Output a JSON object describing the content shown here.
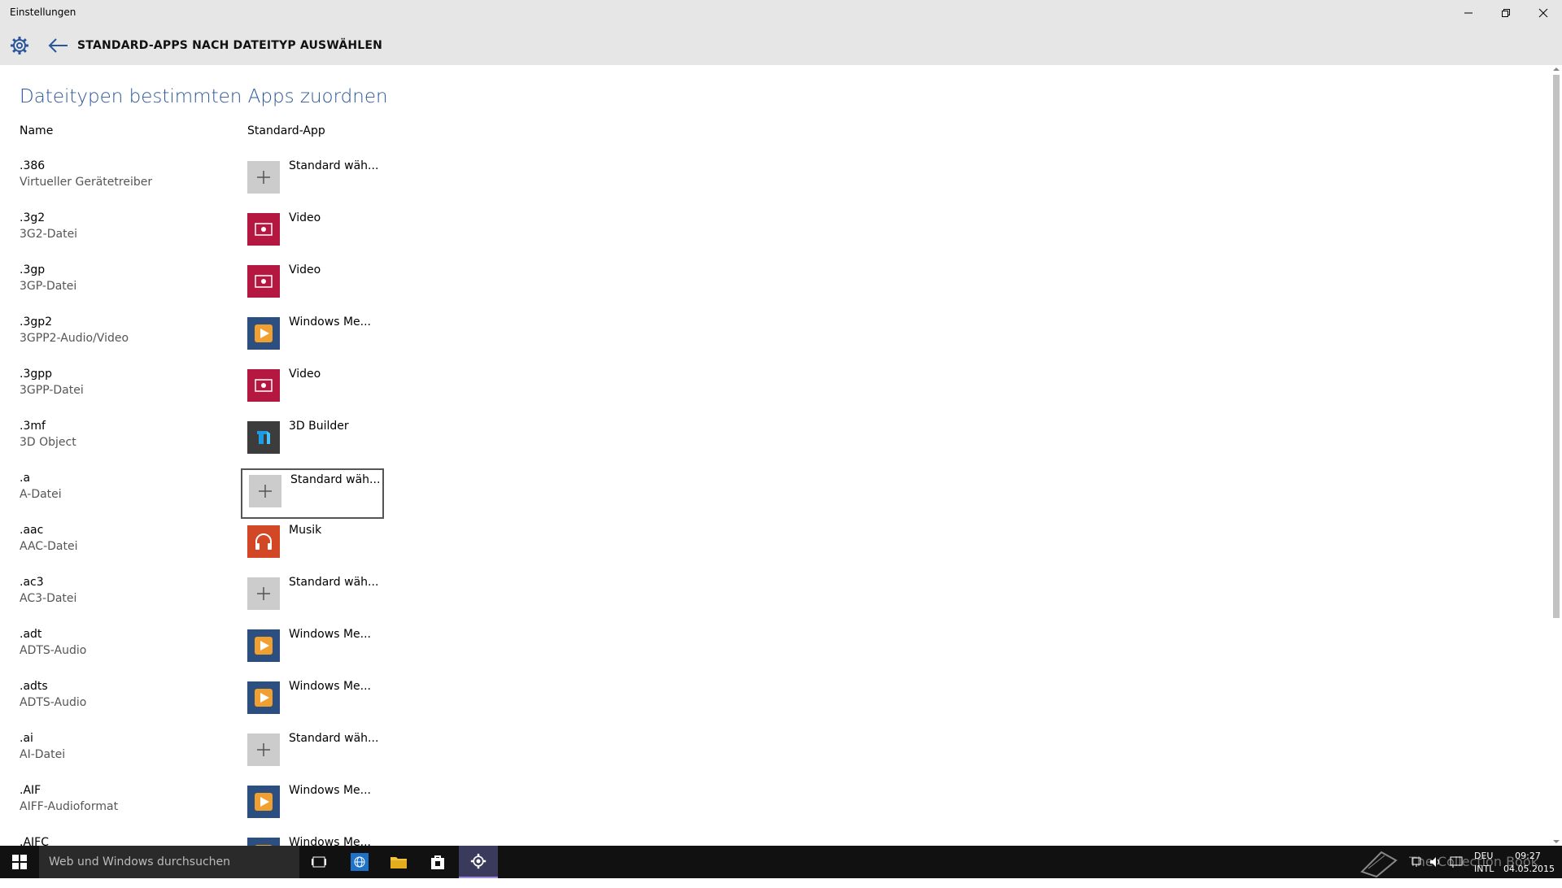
{
  "window": {
    "title": "Einstellungen",
    "controls": [
      "minimize-icon",
      "restore-icon",
      "close-icon"
    ]
  },
  "header": {
    "title": "STANDARD-APPS NACH DATEITYP AUSWÄHLEN",
    "icons": [
      "gear-icon",
      "back-arrow-icon"
    ]
  },
  "main": {
    "title": "Dateitypen bestimmten Apps zuordnen",
    "columns": {
      "name": "Name",
      "app": "Standard-App"
    },
    "rows": [
      {
        "ext": ".386",
        "desc": "Virtueller Gerätetreiber",
        "app": "Standard wäh...",
        "icon": "plus-icon"
      },
      {
        "ext": ".3g2",
        "desc": "3G2-Datei",
        "app": "Video",
        "icon": "video-icon"
      },
      {
        "ext": ".3gp",
        "desc": "3GP-Datei",
        "app": "Video",
        "icon": "video-icon"
      },
      {
        "ext": ".3gp2",
        "desc": "3GPP2-Audio/Video",
        "app": "Windows Me...",
        "icon": "media-player-icon"
      },
      {
        "ext": ".3gpp",
        "desc": "3GPP-Datei",
        "app": "Video",
        "icon": "video-icon"
      },
      {
        "ext": ".3mf",
        "desc": "3D Object",
        "app": "3D Builder",
        "icon": "3d-builder-icon"
      },
      {
        "ext": ".a",
        "desc": "A-Datei",
        "app": "Standard wäh...",
        "icon": "plus-icon",
        "focused": true
      },
      {
        "ext": ".aac",
        "desc": "AAC-Datei",
        "app": "Musik",
        "icon": "music-icon"
      },
      {
        "ext": ".ac3",
        "desc": "AC3-Datei",
        "app": "Standard wäh...",
        "icon": "plus-icon"
      },
      {
        "ext": ".adt",
        "desc": "ADTS-Audio",
        "app": "Windows Me...",
        "icon": "media-player-icon"
      },
      {
        "ext": ".adts",
        "desc": "ADTS-Audio",
        "app": "Windows Me...",
        "icon": "media-player-icon"
      },
      {
        "ext": ".ai",
        "desc": "AI-Datei",
        "app": "Standard wäh...",
        "icon": "plus-icon"
      },
      {
        "ext": ".AIF",
        "desc": "AIFF-Audioformat",
        "app": "Windows Me...",
        "icon": "media-player-icon"
      },
      {
        "ext": ".AIFC",
        "desc": "",
        "app": "Windows Me...",
        "icon": "media-player-icon"
      }
    ]
  },
  "taskbar": {
    "search_placeholder": "Web und Windows durchsuchen",
    "lang_top": "DEU",
    "lang_bottom": "INTL",
    "time": "09:27",
    "date": "04.05.2015",
    "watermark": "The Collection Book"
  },
  "colors": {
    "accent": "#2b579a",
    "video": "#b4173f",
    "music": "#d24726",
    "media_player": "#2c4f80",
    "builder": "#3c3c3c",
    "plus_tile": "#cccccc"
  }
}
